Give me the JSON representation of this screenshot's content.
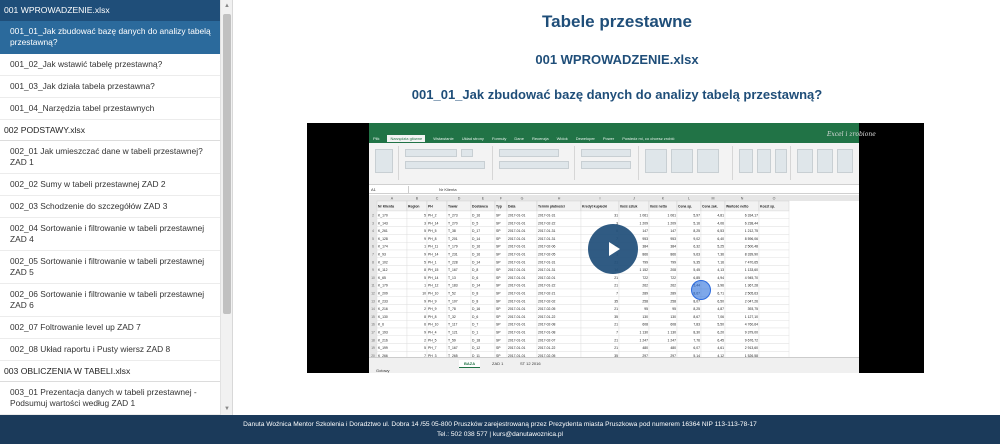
{
  "sidebar": {
    "sections": [
      {
        "title": "001 WPROWADZENIE.xlsx",
        "active": true,
        "items": [
          {
            "label": "001_01_Jak zbudować bazę danych do analizy tabelą przestawną?",
            "active": true
          },
          {
            "label": "001_02_Jak wstawić tabelę przestawną?",
            "active": false
          },
          {
            "label": "001_03_Jak działa tabela przestawna?",
            "active": false
          },
          {
            "label": "001_04_Narzędzia tabel przestawnych",
            "active": false
          }
        ]
      },
      {
        "title": "002 PODSTAWY.xlsx",
        "active": false,
        "items": [
          {
            "label": "002_01 Jak umieszczać dane w tabeli przestawnej? ZAD 1",
            "active": false
          },
          {
            "label": "002_02 Sumy w tabeli przestawnej ZAD 2",
            "active": false
          },
          {
            "label": "002_03 Schodzenie do szczegółów ZAD 3",
            "active": false
          },
          {
            "label": "002_04 Sortowanie i filtrowanie w tabeli przestawnej ZAD 4",
            "active": false
          },
          {
            "label": "002_05 Sortowanie i filtrowanie w tabeli przestawnej ZAD 5",
            "active": false
          },
          {
            "label": "002_06 Sortowanie i filtrowanie w tabeli przestawnej ZAD 6",
            "active": false
          },
          {
            "label": "002_07 Foltrowanie level up ZAD 7",
            "active": false
          },
          {
            "label": "002_08 Układ raportu i Pusty wiersz ZAD 8",
            "active": false
          }
        ]
      },
      {
        "title": "003 OBLICZENIA W TABELI.xlsx",
        "active": false,
        "items": [
          {
            "label": "003_01 Prezentacja danych w tabeli przestawnej - Podsumuj wartości według ZAD 1",
            "active": false
          }
        ]
      }
    ]
  },
  "main": {
    "title": "Tabele przestawne",
    "file": "001 WPROWADZENIE.xlsx",
    "lesson": "001_01_Jak zbudować bazę danych do analizy tabelą przestawną?"
  },
  "video": {
    "watermark": "Excel i zrobione",
    "excel": {
      "tabs": [
        "Plik",
        "Narzędzia główne",
        "Wstawianie",
        "Układ strony",
        "Formuły",
        "Dane",
        "Recenzja",
        "Widok",
        "Deweloper",
        "Power",
        "Powiedz mi, co chcesz zrobić"
      ],
      "active_tab": 1,
      "name_box": "A1",
      "formula": "Nr Klienta",
      "headers": [
        "Nr Klienta",
        "Region",
        "PH",
        "Towar",
        "Dostawca",
        "Typ",
        "Data",
        "Termin płatności",
        "Kredyt kupiecki",
        "Ilość sztuk",
        "Ilość netto",
        "Cena sp.",
        "Cena zak.",
        "Wartość netto",
        "Koszt sp."
      ],
      "rows": [
        [
          "K_170",
          "5",
          "PH_2",
          "T_273",
          "D_16",
          "SP",
          "2017-01-01",
          "2017-01-31",
          "31",
          "1 061",
          "1 061",
          "5,97",
          "4,81",
          "6 334,17",
          ""
        ],
        [
          "K_143",
          "3",
          "PH_14",
          "T_270",
          "D_5",
          "SP",
          "2017-01-01",
          "2017-02-22",
          "3",
          "1 209",
          "1 209",
          "5,16",
          "4,06",
          "6 238,44",
          ""
        ],
        [
          "K_261",
          "5",
          "PH_5",
          "T_38",
          "D_17",
          "SP",
          "2017-01-01",
          "2017-01-31",
          "0",
          "147",
          "147",
          "8,25",
          "6,53",
          "1 212,75",
          ""
        ],
        [
          "K_128",
          "9",
          "PH_8",
          "T_201",
          "D_14",
          "SP",
          "2017-01-01",
          "2017-01-31",
          "7",
          "953",
          "953",
          "9,02",
          "6,40",
          "8 596,06",
          ""
        ],
        [
          "K_174",
          "1",
          "PH_11",
          "T_179",
          "D_16",
          "SP",
          "2017-01-01",
          "2017-02-06",
          "35",
          "384",
          "384",
          "6,32",
          "5,25",
          "2 500,48",
          ""
        ],
        [
          "K_93",
          "9",
          "PH_14",
          "T_231",
          "D_16",
          "SP",
          "2017-01-01",
          "2017-02-05",
          "1",
          "866",
          "866",
          "9,63",
          "7,36",
          "8 339,90",
          ""
        ],
        [
          "K_102",
          "5",
          "PH_1",
          "T_228",
          "D_14",
          "SP",
          "2017-01-01",
          "2017-01-31",
          "21",
          "799",
          "799",
          "9,35",
          "7,16",
          "7 470,65",
          ""
        ],
        [
          "K_112",
          "8",
          "PH_15",
          "T_167",
          "D_8",
          "SP",
          "2017-01-01",
          "2017-01-31",
          "14",
          "1 152",
          "208",
          "5,45",
          "4,13",
          "1 133,60",
          ""
        ],
        [
          "K_65",
          "5",
          "PH_14",
          "T_13",
          "D_6",
          "SP",
          "2017-01-01",
          "2017-02-01",
          "21",
          "722",
          "722",
          "6,85",
          "4,94",
          "4 945,70",
          ""
        ],
        [
          "K_179",
          "1",
          "PH_12",
          "T_183",
          "D_14",
          "SP",
          "2017-01-01",
          "2017-01-22",
          "21",
          "262",
          "262",
          "5,44",
          "3,96",
          "1 367,28",
          ""
        ],
        [
          "K_209",
          "10",
          "PH_10",
          "T_52",
          "D_8",
          "SP",
          "2017-01-01",
          "2017-02-21",
          "7",
          "289",
          "289",
          "8,67",
          "6,71",
          "2 505,63",
          ""
        ],
        [
          "K_233",
          "9",
          "PH_9",
          "T_107",
          "D_8",
          "SP",
          "2017-01-01",
          "2017-02-02",
          "35",
          "258",
          "258",
          "8,07",
          "6,50",
          "2 047,26",
          ""
        ],
        [
          "K_216",
          "2",
          "PH_9",
          "T_78",
          "D_16",
          "SP",
          "2017-01-01",
          "2017-02-05",
          "21",
          "95",
          "95",
          "8,25",
          "4,87",
          "393,75",
          ""
        ],
        [
          "K_130",
          "8",
          "PH_8",
          "T_32",
          "D_6",
          "SP",
          "2017-01-01",
          "2017-01-22",
          "35",
          "130",
          "130",
          "8,67",
          "7,06",
          "1 127,10",
          ""
        ],
        [
          "K_6",
          "6",
          "PH_10",
          "T_117",
          "D_7",
          "SP",
          "2017-01-01",
          "2017-02-08",
          "21",
          "608",
          "608",
          "7,83",
          "5,50",
          "4 760,64",
          ""
        ],
        [
          "K_193",
          "9",
          "PH_4",
          "T_121",
          "D_1",
          "SP",
          "2017-01-01",
          "2017-01-08",
          "7",
          "1 130",
          "1 130",
          "8,30",
          "6,20",
          "9 379,00",
          ""
        ],
        [
          "K_216",
          "2",
          "PH_5",
          "T_59",
          "D_18",
          "SP",
          "2017-01-01",
          "2017-02-07",
          "21",
          "1 247",
          "1 247",
          "7,76",
          "6,45",
          "9 676,72",
          ""
        ],
        [
          "K_199",
          "5",
          "PH_7",
          "T_167",
          "D_12",
          "SP",
          "2017-01-01",
          "2017-01-22",
          "21",
          "480",
          "480",
          "6,07",
          "4,61",
          "2 913,60",
          ""
        ],
        [
          "K_266",
          "7",
          "PH_3",
          "T_265",
          "D_11",
          "SP",
          "2017-01-01",
          "2017-02-05",
          "35",
          "297",
          "297",
          "5,14",
          "4,12",
          "1 526,58",
          ""
        ]
      ],
      "sheets": [
        "BAZA",
        "ZAD 1",
        "ST 12 2016"
      ],
      "active_sheet": 0,
      "status": "Gotowy"
    }
  },
  "footer": {
    "line1": "Danuta Woźnica Mentor Szkolenia i Doradztwo ul. Dobra 14 /55 05-800 Pruszków zarejestrowaną przez Prezydenta miasta Pruszkowa pod numerem 16364 NIP 113-113-78-17",
    "line2": "Tel.: 502 038 577 | kurs@danutawoznica.pl"
  },
  "colors": {
    "primary": "#1f4e79",
    "active_item": "#2b6a9c",
    "footer": "#1b3a5a",
    "excel_green": "#217346"
  }
}
